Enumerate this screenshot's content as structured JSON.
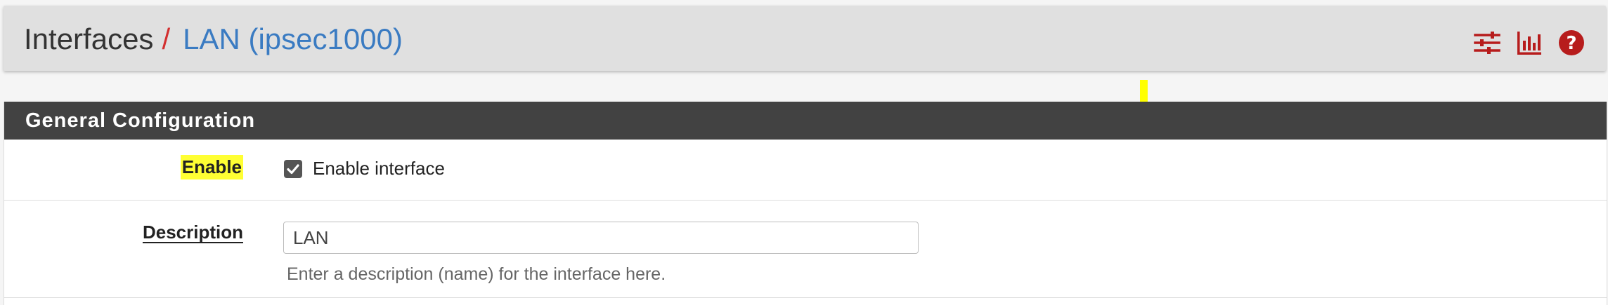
{
  "breadcrumb": {
    "root": "Interfaces",
    "separator": "/",
    "current": "LAN (ipsec1000)"
  },
  "header_icons": [
    "sliders-icon",
    "bar-chart-icon",
    "help-icon"
  ],
  "colors": {
    "accent_red": "#b71c1c",
    "link_blue": "#3a7bc2",
    "panel_heading_bg": "#424242",
    "highlight": "#ffff33"
  },
  "panel": {
    "heading": "General Configuration",
    "enable": {
      "label": "Enable",
      "checkbox_label": "Enable interface",
      "checked": true
    },
    "description": {
      "label": "Description",
      "value": "LAN",
      "help": "Enter a description (name) for the interface here."
    }
  }
}
